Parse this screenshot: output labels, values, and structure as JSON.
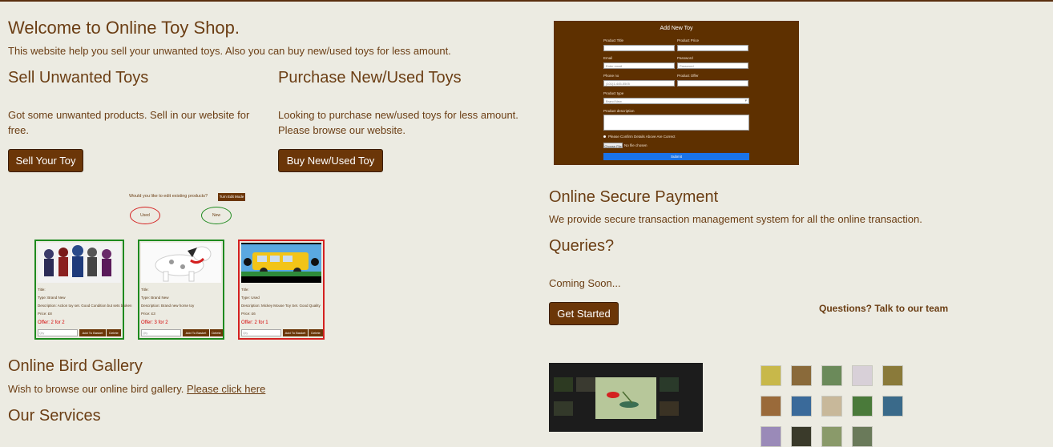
{
  "welcome": {
    "title": "Welcome to Online Toy Shop.",
    "subtitle": "This website help you sell your unwanted toys. Also you can buy new/used toys for less amount."
  },
  "sell": {
    "heading": "Sell Unwanted Toys",
    "text": "Got some unwanted products. Sell in our website for free.",
    "button": "Sell Your Toy"
  },
  "purchase": {
    "heading": "Purchase New/Used Toys",
    "text": "Looking to purchase new/used toys for less amount. Please browse our website.",
    "button": "Buy New/Used Toy"
  },
  "add_form": {
    "title": "Add New Toy",
    "product_title_label": "Product Title",
    "product_price_label": "Product Price",
    "email_label": "Email",
    "email_placeholder": "Enter email",
    "password_label": "Password",
    "password_placeholder": "Password",
    "phone_label": "Phone no",
    "phone_placeholder": "(101)1-445-5505",
    "offer_label": "Product Offer",
    "type_label": "Product type",
    "type_selected": "Brand New",
    "description_label": "Product description",
    "confirm_label": "Please Confirm Details Above Are Correct",
    "file_button": "Choose File",
    "file_status": "No file chosen",
    "submit": "Submit"
  },
  "edit_prompt": {
    "text": "Would you like to edit existing products?",
    "button": "Turn Edit Mode",
    "used_label": "Used",
    "new_label": "New"
  },
  "cards": [
    {
      "title": "Title:",
      "type": "Type: Brand New",
      "description": "Description: Action toy set. Good Condition but sets broken",
      "price": "Price: £8",
      "offer": "Offer: 2 for 2",
      "qty_placeholder": "Qty",
      "add_label": "Add To Basket",
      "delete_label": "Delete",
      "border_color": "#1e8a1e"
    },
    {
      "title": "Title:",
      "type": "Type: Brand New",
      "description": "Description: Brand new horse toy",
      "price": "Price: £3",
      "offer": "Offer: 3 for 2",
      "qty_placeholder": "Qty",
      "add_label": "Add To Basket",
      "delete_label": "Delete",
      "border_color": "#1e8a1e"
    },
    {
      "title": "Title:",
      "type": "Type: Used",
      "description": "Description: Mickey Mouse Toy Set. Good Quality",
      "price": "Price: £6",
      "offer": "Offer: 2 for 1",
      "qty_placeholder": "Qty",
      "add_label": "Add To Basket",
      "delete_label": "Delete",
      "border_color": "#d42020"
    }
  ],
  "payment": {
    "heading": "Online Secure Payment",
    "text": "We provide secure transaction management system for all the online transaction."
  },
  "queries": {
    "heading": "Queries?",
    "text": "Coming Soon...",
    "button": "Get Started",
    "team": "Questions? Talk to our team"
  },
  "bird": {
    "heading": "Online Bird Gallery",
    "text": "Wish to browse our online bird gallery.",
    "link": "Please click here"
  },
  "services": {
    "heading": "Our Services"
  },
  "colors": {
    "accent_brown": "#6b3608",
    "background": "#ecebe2",
    "form_bg": "#5e3000",
    "submit_blue": "#1a73e8"
  }
}
